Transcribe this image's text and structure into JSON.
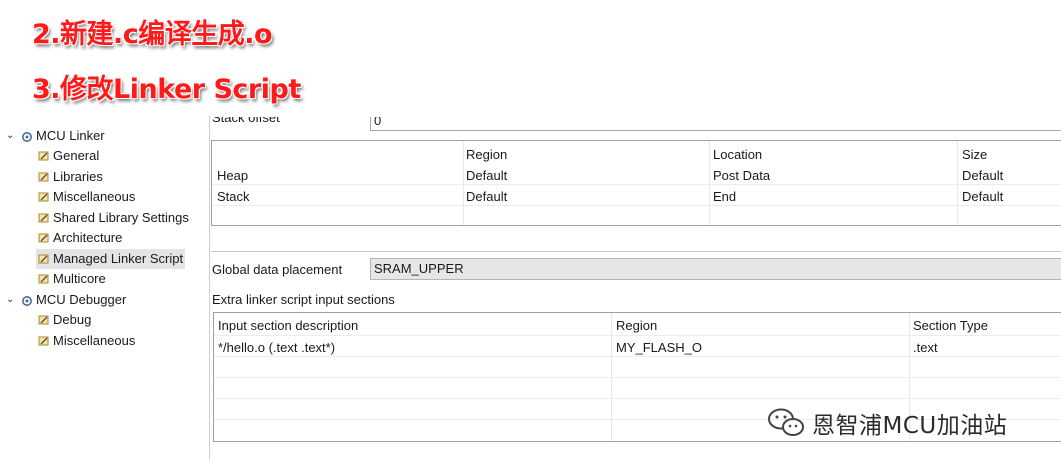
{
  "annotations": {
    "step2": "2.新建.c编译生成.o",
    "step3": "3.修改Linker Script"
  },
  "tree": {
    "mcu_linker": {
      "label": "MCU Linker",
      "children": [
        "General",
        "Libraries",
        "Miscellaneous",
        "Shared Library Settings",
        "Architecture",
        "Managed Linker Script",
        "Multicore"
      ]
    },
    "mcu_debugger": {
      "label": "MCU Debugger",
      "children": [
        "Debug",
        "Miscellaneous"
      ]
    },
    "selected": "Managed Linker Script"
  },
  "stack_offset": {
    "label": "Stack offset",
    "value": "0"
  },
  "heap_stack_table": {
    "columns": [
      "",
      "Region",
      "Location",
      "Size"
    ],
    "rows": [
      [
        "Heap",
        "Default",
        "Post Data",
        "Default"
      ],
      [
        "Stack",
        "Default",
        "End",
        "Default"
      ]
    ]
  },
  "global_data_placement": {
    "label": "Global data placement",
    "value": "SRAM_UPPER"
  },
  "extra_sections": {
    "label": "Extra linker script input sections",
    "columns": [
      "Input section description",
      "Region",
      "Section Type"
    ],
    "rows": [
      [
        "*/hello.o (.text .text*)",
        "MY_FLASH_O",
        ".text"
      ]
    ]
  },
  "watermark": {
    "text": "恩智浦MCU加油站"
  }
}
